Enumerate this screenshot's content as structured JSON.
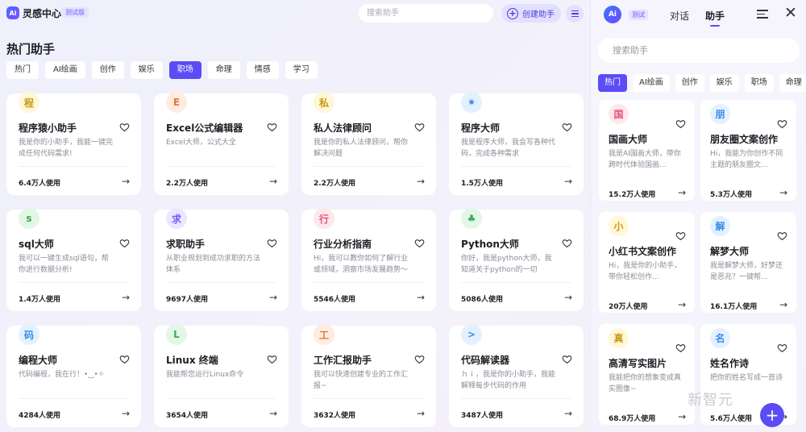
{
  "header": {
    "logo": "Ai",
    "title": "灵感中心",
    "beta": "测试版",
    "search_placeholder": "搜索助手",
    "create_label": "创建助手"
  },
  "section_title": "热门助手",
  "tabs": [
    "热门",
    "AI绘画",
    "创作",
    "娱乐",
    "职场",
    "命理",
    "情感",
    "学习"
  ],
  "active_tab": "职场",
  "cards": [
    {
      "avatar": "程",
      "bg": "#fff7d6",
      "fg": "#c89a1a",
      "name": "程序猿小助手",
      "desc": "我是你的小助手，我能一键完成任何代码需求!",
      "usage": "6.4万人使用"
    },
    {
      "avatar": "E",
      "bg": "#ffece0",
      "fg": "#e07b3a",
      "name": "Excel公式编辑器",
      "desc": "Excel大师，公式大全",
      "usage": "2.2万人使用"
    },
    {
      "avatar": "私",
      "bg": "#fff7d6",
      "fg": "#c89a1a",
      "name": "私人法律顾问",
      "desc": "我是你的私人法律顾问，帮你解决问题",
      "usage": "2.2万人使用"
    },
    {
      "avatar": "✷",
      "bg": "#e3f1ff",
      "fg": "#3c8be8",
      "name": "程序大师",
      "desc": "我是程序大师，我会写各种代码，完成各种需求",
      "usage": "1.5万人使用"
    },
    {
      "avatar": "s",
      "bg": "#e2f7e6",
      "fg": "#3ca958",
      "name": "sql大师",
      "desc": "我可以一键生成sql语句，帮你进行数据分析!",
      "usage": "1.4万人使用"
    },
    {
      "avatar": "求",
      "bg": "#ebe7ff",
      "fg": "#6a5cff",
      "name": "求职助手",
      "desc": "从职业规划到成功求职的方法体系",
      "usage": "9697人使用"
    },
    {
      "avatar": "行",
      "bg": "#ffe7ee",
      "fg": "#e0557a",
      "name": "行业分析指南",
      "desc": "Hi，我可以教你如何了解行业或领域，洞察市场发展趋势～",
      "usage": "5546人使用"
    },
    {
      "avatar": "♣",
      "bg": "#e2f7e6",
      "fg": "#3ca958",
      "name": "Python大师",
      "desc": "你好，我是python大师，我知道关于python的一切",
      "usage": "5086人使用"
    },
    {
      "avatar": "码",
      "bg": "#e3f1ff",
      "fg": "#3c8be8",
      "name": "编程大师",
      "desc": "代码编程，我在行！•‿•✧",
      "usage": "4284人使用"
    },
    {
      "avatar": "L",
      "bg": "#e2f7e6",
      "fg": "#3ca958",
      "name": "Linux 终端",
      "desc": "我能帮您运行Linux命令",
      "usage": "3654人使用"
    },
    {
      "avatar": "工",
      "bg": "#ffece0",
      "fg": "#e07b3a",
      "name": "工作汇报助手",
      "desc": "我可以快速创建专业的工作汇报~",
      "usage": "3632人使用"
    },
    {
      "avatar": ">",
      "bg": "#e3f1ff",
      "fg": "#3c8be8",
      "name": "代码解读器",
      "desc": "ｈｉ，我是你的小助手，我能解释每步代码的作用",
      "usage": "3487人使用"
    }
  ],
  "right_panel": {
    "logo": "Ai",
    "beta": "测试",
    "tab_chat": "对话",
    "tab_assistant": "助手",
    "search_placeholder": "搜索助手",
    "tabs": [
      "热门",
      "AI绘画",
      "创作",
      "娱乐",
      "职场",
      "命理"
    ],
    "active_tab": "热门",
    "cards": [
      {
        "avatar": "国",
        "bg": "#ffe7ee",
        "fg": "#e0557a",
        "name": "国画大师",
        "desc": "我是AI国画大师，带你跨时代体验国画...",
        "usage": "15.2万人使用"
      },
      {
        "avatar": "朋",
        "bg": "#e3f1ff",
        "fg": "#3c8be8",
        "name": "朋友圈文案创作",
        "desc": "Hi，我能为你创作不同主题的朋友圈文...",
        "usage": "5.3万人使用"
      },
      {
        "avatar": "小",
        "bg": "#fff7d6",
        "fg": "#c89a1a",
        "name": "小红书文案创作",
        "desc": "Hi，我是你的小助手，带你轻松创作...",
        "usage": "20万人使用"
      },
      {
        "avatar": "解",
        "bg": "#e3f1ff",
        "fg": "#3c8be8",
        "name": "解梦大师",
        "desc": "我是解梦大师，好梦还是恶兆？一键帮...",
        "usage": "16.1万人使用"
      },
      {
        "avatar": "真",
        "bg": "#fff7d6",
        "fg": "#c89a1a",
        "name": "高清写实图片",
        "desc": "我能把你的想象变成真实图像~",
        "usage": "68.9万人使用"
      },
      {
        "avatar": "名",
        "bg": "#e3f1ff",
        "fg": "#3c8be8",
        "name": "姓名作诗",
        "desc": "把你的姓名写成一首诗",
        "usage": "5.6万人使用"
      }
    ]
  },
  "watermark": "新智元"
}
